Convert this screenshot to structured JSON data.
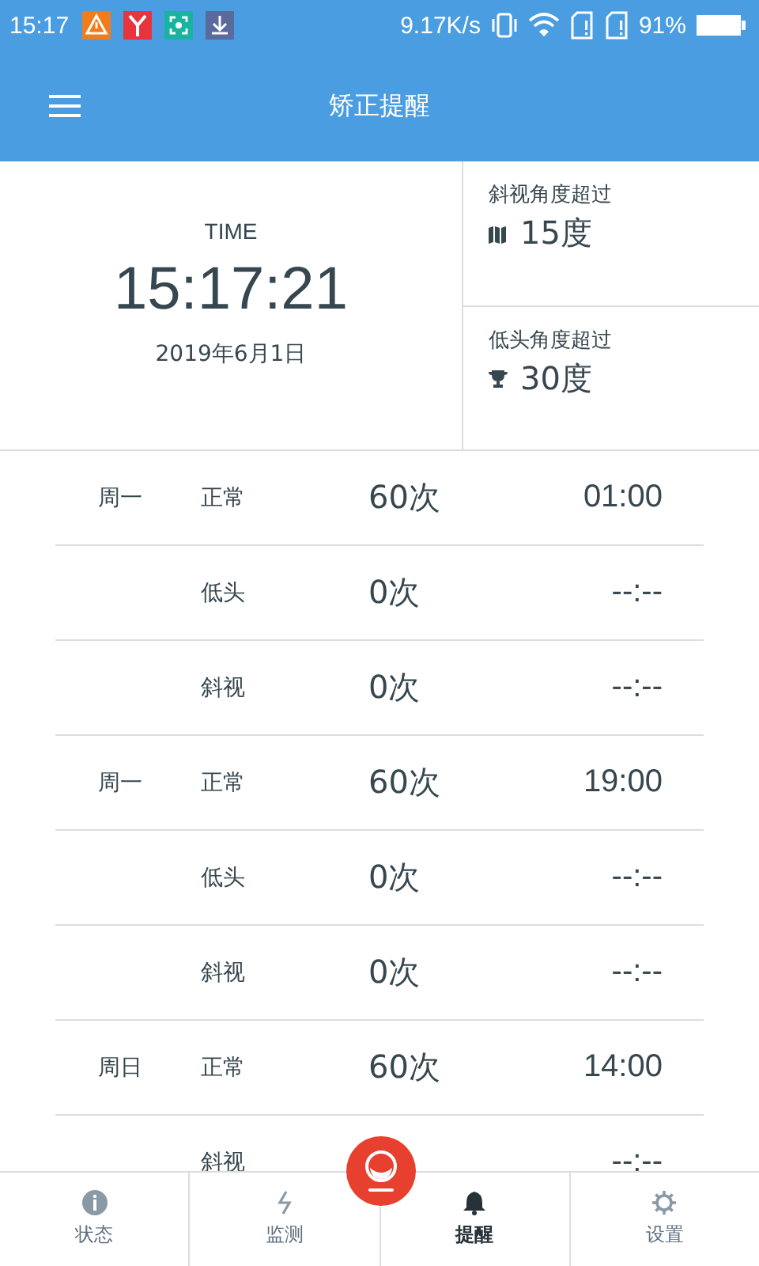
{
  "status_bar": {
    "time": "15:17",
    "speed": "9.17K/s",
    "battery": "91%"
  },
  "app_bar": {
    "title": "矫正提醒"
  },
  "clock": {
    "label": "TIME",
    "time": "15:17:21",
    "date": "2019年6月1日"
  },
  "thresholds": [
    {
      "kind": "squint",
      "label": "斜视角度超过",
      "value": "15度"
    },
    {
      "kind": "trophy",
      "label": "低头角度超过",
      "value": "30度"
    }
  ],
  "records": [
    {
      "day": "周一",
      "type": "正常",
      "count": "60次",
      "time": "01:00"
    },
    {
      "type": "低头",
      "count": "0次",
      "time": "--:--"
    },
    {
      "type": "斜视",
      "count": "0次",
      "time": "--:--"
    },
    {
      "day": "周一",
      "type": "正常",
      "count": "60次",
      "time": "19:00"
    },
    {
      "type": "低头",
      "count": "0次",
      "time": "--:--"
    },
    {
      "type": "斜视",
      "count": "0次",
      "time": "--:--"
    },
    {
      "day": "周日",
      "type": "正常",
      "count": "60次",
      "time": "14:00"
    },
    {
      "type": "斜视",
      "time": "--:--"
    }
  ],
  "nav": [
    {
      "kind": "status",
      "label": "状态",
      "selected": false
    },
    {
      "kind": "monitor",
      "label": "监测",
      "selected": false
    },
    {
      "kind": "remind",
      "label": "提醒",
      "selected": true
    },
    {
      "kind": "settings",
      "label": "设置",
      "selected": false
    }
  ]
}
